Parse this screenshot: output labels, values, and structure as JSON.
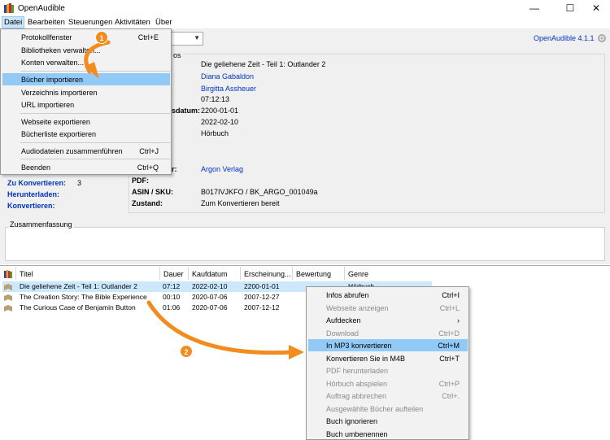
{
  "window": {
    "title": "OpenAudible",
    "minimize": "—",
    "maximize": "☐",
    "close": "✕"
  },
  "menubar": [
    "Datei",
    "Bearbeiten",
    "Steuerungen",
    "Aktivitäten",
    "Über"
  ],
  "version": "OpenAudible 4.1.1",
  "details": {
    "group_label": "os",
    "title_value": "Die geliehene Zeit - Teil 1: Outlander 2",
    "author": "Diana Gabaldon",
    "narrator": "Birgitta Assheuer",
    "duration": "07:12:13",
    "release_label": "sdatum:",
    "release_date": "2200-01-01",
    "purchase_date": "2022-02-10",
    "format": "Hörbuch",
    "publisher_label": "r:",
    "publisher": "Argon Verlag",
    "pdf_label": "PDF:",
    "asin_label": "ASIN / SKU:",
    "asin_value": "B017IVJKFO / BK_ARGO_001049a",
    "state_label": "Zustand:",
    "state_value": "Zum Konvertieren bereit"
  },
  "stats": {
    "to_convert_label": "Zu Konvertieren:",
    "to_convert_value": "3",
    "downloading_label": "Herunterladen:",
    "converting_label": "Konvertieren:"
  },
  "summary_label": "Zusammenfassung",
  "table": {
    "headers": [
      "Titel",
      "Dauer",
      "Kaufdatum",
      "Erscheinung...",
      "Bewertung",
      "Genre"
    ],
    "rows": [
      [
        "Die geliehene Zeit - Teil 1: Outlander 2",
        "07:12",
        "2022-02-10",
        "2200-01-01",
        "",
        "Hörbuch"
      ],
      [
        "The Creation Story: The Bible Experience",
        "00:10",
        "2020-07-06",
        "2007-12-27",
        "",
        ""
      ],
      [
        "The Curious Case of Benjamin Button",
        "01:06",
        "2020-07-06",
        "2007-12-12",
        "",
        ""
      ]
    ]
  },
  "file_menu": [
    {
      "label": "Protokollfenster",
      "shortcut": "Ctrl+E"
    },
    {
      "label": "Bibliotheken verwalten...",
      "shortcut": ""
    },
    {
      "label": "Konten verwalten...",
      "shortcut": ""
    },
    {
      "label": "Bücher importieren",
      "shortcut": ""
    },
    {
      "label": "Verzeichnis importieren",
      "shortcut": ""
    },
    {
      "label": "URL importieren",
      "shortcut": ""
    },
    {
      "label": "Webseite exportieren",
      "shortcut": ""
    },
    {
      "label": "Bücherliste exportieren",
      "shortcut": ""
    },
    {
      "label": "Audiodateien zusammenführen",
      "shortcut": "Ctrl+J"
    },
    {
      "label": "Beenden",
      "shortcut": "Ctrl+Q"
    }
  ],
  "context_menu": [
    {
      "label": "Infos abrufen",
      "shortcut": "Ctrl+I"
    },
    {
      "label": "Webseite anzeigen",
      "shortcut": "Ctrl+L"
    },
    {
      "label": "Aufdecken",
      "shortcut": "›"
    },
    {
      "label": "Download",
      "shortcut": "Ctrl+D"
    },
    {
      "label": "In MP3 konvertieren",
      "shortcut": "Ctrl+M"
    },
    {
      "label": "Konvertieren Sie in M4B",
      "shortcut": "Ctrl+T"
    },
    {
      "label": "PDF herunterladen",
      "shortcut": ""
    },
    {
      "label": "Hörbuch abspielen",
      "shortcut": "Ctrl+P"
    },
    {
      "label": "Auftrag abbrechen",
      "shortcut": "Ctrl+."
    },
    {
      "label": "Ausgewählte Bücher aufteilen",
      "shortcut": ""
    },
    {
      "label": "Buch ignorieren",
      "shortcut": ""
    },
    {
      "label": "Buch umbenennen",
      "shortcut": ""
    }
  ],
  "annotations": [
    "1",
    "2"
  ],
  "colors": {
    "accent_orange": "#f28c1f",
    "link_blue": "#0033cc",
    "highlight": "#91c9f7",
    "selection": "#cce8ff"
  }
}
